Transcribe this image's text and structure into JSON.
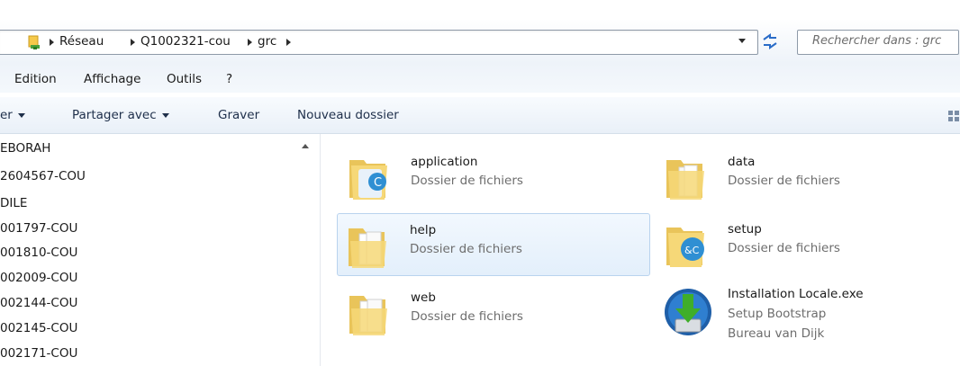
{
  "address_bar": {
    "breadcrumbs": [
      "Réseau",
      "Q1002321-cou",
      "grc"
    ],
    "search_placeholder": "Rechercher dans : grc"
  },
  "menu": {
    "items": [
      "Edition",
      "Affichage",
      "Outils",
      "?"
    ]
  },
  "command_bar": {
    "items": [
      {
        "label": "er",
        "has_dropdown": true
      },
      {
        "label": "Partager avec",
        "has_dropdown": true
      },
      {
        "label": "Graver",
        "has_dropdown": false
      },
      {
        "label": "Nouveau dossier",
        "has_dropdown": false
      }
    ]
  },
  "nav_pane": {
    "items": [
      "EBORAH",
      "2604567-COU",
      "DILE",
      "001797-COU",
      "001810-COU",
      "002009-COU",
      "002144-COU",
      "002145-COU",
      "002171-COU"
    ]
  },
  "files": [
    {
      "name": "application",
      "type": "Dossier de fichiers",
      "icon": "folder-app-icon"
    },
    {
      "name": "data",
      "type": "Dossier de fichiers",
      "icon": "folder-icon"
    },
    {
      "name": "help",
      "type": "Dossier de fichiers",
      "icon": "folder-docs-icon",
      "selected": true
    },
    {
      "name": "setup",
      "type": "Dossier de fichiers",
      "icon": "folder-setup-icon"
    },
    {
      "name": "web",
      "type": "Dossier de fichiers",
      "icon": "folder-docs-icon"
    },
    {
      "name": "Installation Locale.exe",
      "type": "Setup Bootstrap",
      "publisher": "Bureau van Dijk",
      "icon": "installer-icon"
    }
  ],
  "colors": {
    "accent": "#2a6cc8",
    "selection_border": "#b9d3ee",
    "folder": "#f3d36c"
  }
}
